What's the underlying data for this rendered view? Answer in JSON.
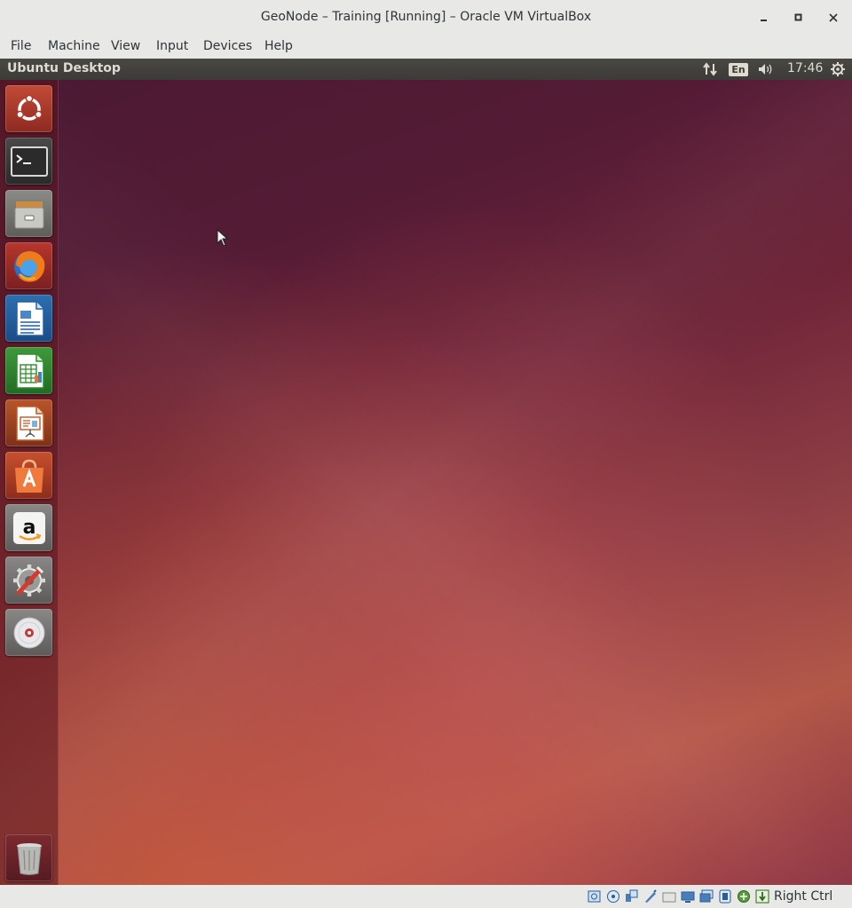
{
  "window": {
    "title": "GeoNode – Training [Running] – Oracle VM VirtualBox"
  },
  "menubar": {
    "items": [
      "File",
      "Machine",
      "View",
      "Input",
      "Devices",
      "Help"
    ]
  },
  "panel": {
    "title": "Ubuntu Desktop",
    "keyboard_layout": "En",
    "clock": "17:46"
  },
  "launcher": {
    "icons": [
      "dash-home-icon",
      "terminal-icon",
      "files-icon",
      "firefox-icon",
      "libreoffice-writer-icon",
      "libreoffice-calc-icon",
      "libreoffice-impress-icon",
      "software-center-icon",
      "amazon-icon",
      "system-settings-icon",
      "dvd-drive-icon",
      "trash-icon"
    ]
  },
  "statusbar": {
    "host_key": "Right Ctrl",
    "icons": [
      "hard-disk-icon",
      "optical-drive-icon",
      "audio-icon",
      "network-icon",
      "usb-icon",
      "shared-folders-icon",
      "display-icon",
      "recording-icon",
      "cpu-icon",
      "mouse-integration-icon",
      "keyboard-capture-icon"
    ]
  },
  "colors": {
    "panel_bg": "#3c3b37",
    "chrome_bg": "#e8e8e7",
    "text": "#2e3436",
    "launcher_bg": "#5c1c25"
  }
}
